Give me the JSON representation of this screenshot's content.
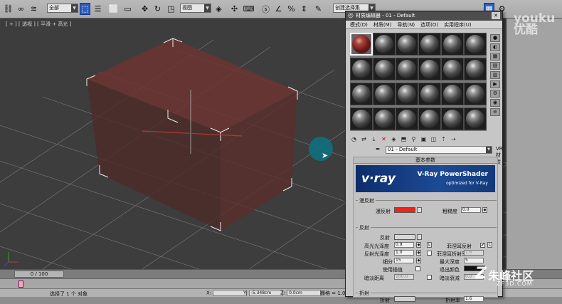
{
  "toolbar": {
    "selection_filter": "全部",
    "ref_coord": "视图",
    "named_sel": "创建选择集"
  },
  "viewport": {
    "label": "[ + ] [ 透视 ] [ 平滑 + 高光 ]"
  },
  "timeline": {
    "frame": "0 / 100"
  },
  "status": {
    "text": "选择了 1 个 对象",
    "x_label": "X:",
    "x_value": "",
    "y_label": "Y:",
    "y_value": "-5.348cm",
    "z_label": "Z:",
    "z_value": "0.0cm",
    "grid_label": "栅格 = 1.0"
  },
  "material_editor": {
    "title": "材质编辑器 - 01 - Default",
    "menus": [
      "模式(D)",
      "材质(M)",
      "导航(N)",
      "选项(O)",
      "实用程序(U)"
    ],
    "material_name": "01 - Default",
    "material_type": "VR材质",
    "rollout_header": "基本参数",
    "banner": {
      "logo": "v·ray",
      "title": "V-Ray PowerShader",
      "subtitle": "optimized for V-Ray"
    },
    "diffuse_group": {
      "title": "漫反射",
      "diffuse_label": "漫反射",
      "diffuse_color": "#e8261c",
      "roughness_label": "粗糙度",
      "roughness_value": "0.0"
    },
    "reflection_group": {
      "title": "反射",
      "reflect_label": "反射",
      "reflect_color": "#d8d8d8",
      "hilight_gloss_label": "高光光泽度",
      "hilight_gloss_value": "0.9",
      "lock_label": "L",
      "fresnel_label": "菲涅耳反射",
      "fresnel_check": "✔",
      "fresnel_lock": "L",
      "refl_gloss_label": "反射光泽度",
      "refl_gloss_value": "1.0",
      "fresnel_ior_label": "菲涅耳折射率",
      "fresnel_ior_value": "1.6",
      "subdivs_label": "细分",
      "subdivs_value": "15",
      "max_depth_label": "最大深度",
      "max_depth_value": "5",
      "interp_label": "使用插值",
      "exit_color_label": "退出颜色",
      "exit_color": "#111111",
      "dim_dist_label": "暗淡距离",
      "dim_dist_value": "100.0",
      "dim_falloff_label": "暗淡衰减",
      "dim_falloff_value": "0.0"
    },
    "refraction_group": {
      "title": "折射",
      "refract_label": "折射",
      "refract_color": "#d0d0d0",
      "ior_label": "折射率",
      "ior_value": "1.6"
    }
  },
  "watermarks": {
    "youku_cn": "优酷",
    "youku_en": "youku",
    "zf_name": "朱峰社区",
    "zf_domain": "ZF3D.COM"
  }
}
